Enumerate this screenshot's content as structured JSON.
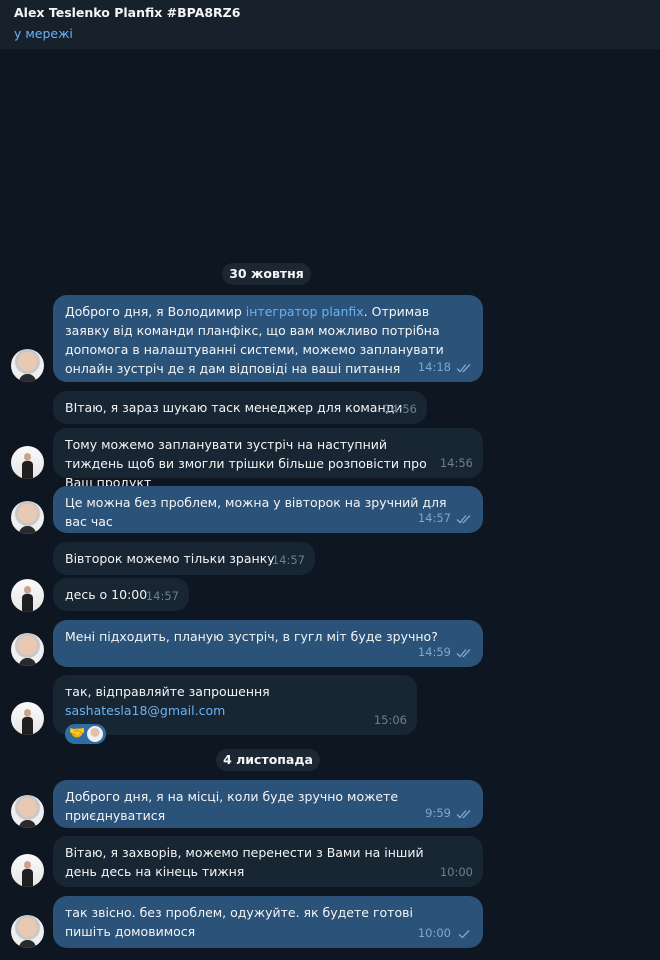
{
  "header": {
    "title": "Alex Teslenko Planfix #BPA8RZ6",
    "status": "у мережі"
  },
  "dates": [
    "30 жовтня",
    "4 листопада"
  ],
  "messages": [
    {
      "direction": "out",
      "text_before": "Доброго дня, я Володимир ",
      "link": "інтегратор planfix",
      "text_after": ". Отримав заявку від команди планфікс, що вам можливо потрібна допомога в налаштуванні системи, можемо запланувати онлайн зустріч де я дам відповіді на ваші питання",
      "time": "14:18",
      "status": "read"
    },
    {
      "direction": "in",
      "text": "ВІтаю, я зараз шукаю таск менеджер для команди",
      "time": "14:56"
    },
    {
      "direction": "in",
      "text": "Тому можемо запланувати зустріч на наступний тиждень щоб ви змогли трішки більше розповісти про Ваш продукт",
      "time": "14:56"
    },
    {
      "direction": "out",
      "text": "Це можна без проблем, можна у вівторок на зручний для вас час",
      "time": "14:57",
      "status": "read"
    },
    {
      "direction": "in",
      "text": "Вівторок можемо тільки зранку",
      "time": "14:57"
    },
    {
      "direction": "in",
      "text": "десь о 10:00",
      "time": "14:57"
    },
    {
      "direction": "out",
      "text": "Мені підходить, планую зустріч, в гугл міт буде зручно?",
      "time": "14:59",
      "status": "read"
    },
    {
      "direction": "in",
      "text_before": "так, відправляйте запрошення ",
      "link": "sashatesla18@gmail.com",
      "reaction": "🤝",
      "time": "15:06"
    },
    {
      "direction": "out",
      "text": "Доброго дня, я на місці, коли буде зручно можете приєднуватися",
      "time": "9:59",
      "status": "read"
    },
    {
      "direction": "in",
      "text": "Вітаю, я захворів, можемо перенести з Вами на інший день десь на кінець тижня",
      "time": "10:00"
    },
    {
      "direction": "out",
      "text": "так звісно. без проблем, одужуйте. як будете готові пишіть домовимося",
      "time": "10:00",
      "status": "sent"
    }
  ],
  "colors": {
    "background": "#0e1621",
    "header": "#17212b",
    "incoming": "#182533",
    "outgoing": "#2b5278",
    "link": "#6ab3f3"
  },
  "icons": {
    "read": "double-check-icon",
    "sent": "single-check-icon"
  }
}
